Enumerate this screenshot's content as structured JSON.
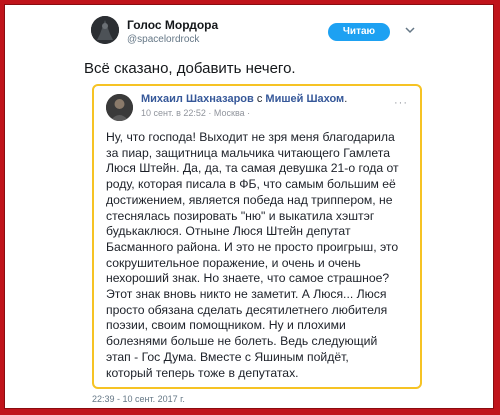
{
  "tweet": {
    "author_name": "Голос Мордора",
    "author_handle": "@spacelordrock",
    "follow_label": "Читаю",
    "text": "Всё сказано, добавить нечего.",
    "timestamp": "22:39 - 10 сент. 2017 г."
  },
  "quote": {
    "author": "Михаил Шахназаров",
    "with_word": "с",
    "tagged": "Мишей Шахом",
    "meta": "10 сент. в 22:52 · Москва ·",
    "body_lines": [
      "Ну, что господа! Выходит не зря меня благодарила",
      "за пиар, защитница мальчика читающего Гамлета",
      "Люся Штейн. Да, да, та самая девушка 21-о года от",
      "роду, которая писала в ФБ, что самым большим её",
      "достижением, является победа над триппером, не",
      "стеснялась позировать \"ню\" и выкатила хэштэг",
      "будькаклюся. Отныне Люся Штейн депутат",
      "Басманного района. И это не просто проигрыш, это",
      "сокрушительное поражение, и очень и очень",
      "нехороший знак. Но знаете, что самое страшное?",
      "Этот знак вновь никто не заметит. А Люся... Люся",
      "просто обязана сделать десятилетнего любителя",
      "поэзии, своим помощником. Ну и плохими",
      "болезнями больше не болеть. Ведь следующий",
      "этап - Гос Дума. Вместе с Яшиным пойдёт,",
      "который теперь тоже в депутатах."
    ]
  },
  "colors": {
    "border": "#c0141b",
    "quote_highlight": "#f6c324",
    "follow_button": "#1da1f2"
  }
}
